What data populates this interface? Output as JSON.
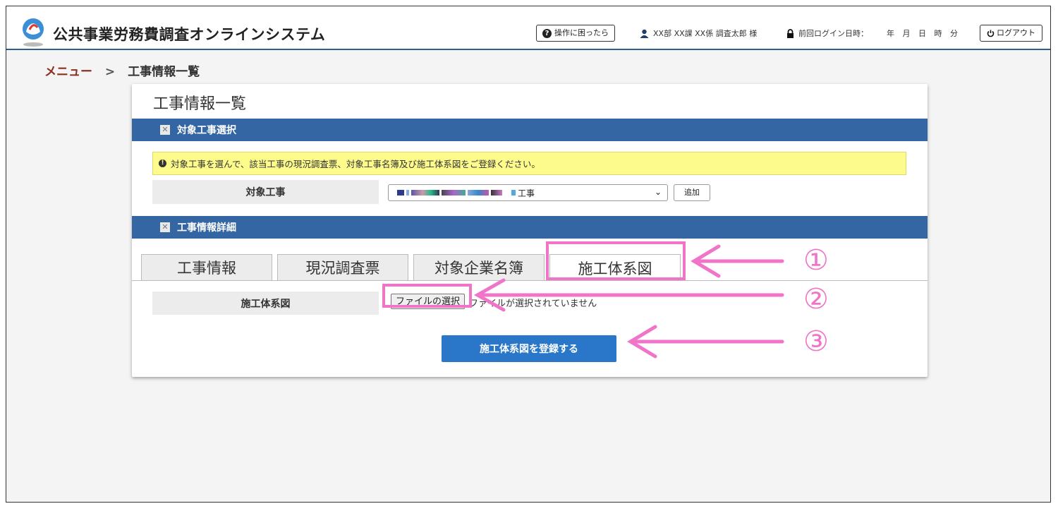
{
  "header": {
    "app_title": "公共事業労務費調査オンラインシステム",
    "help_label": "操作に困ったら",
    "user_label": "XX部 XX課 XX係 調査太郎 様",
    "last_login_label": "前回ログイン日時：",
    "last_login_value": "年 月 日 時 分",
    "logout_label": "ログアウト",
    "icons": [
      "logo",
      "help-icon",
      "user-icon",
      "lock-icon",
      "power-icon"
    ]
  },
  "breadcrumb": {
    "menu": "メニュー",
    "separator": ">",
    "current": "工事情報一覧"
  },
  "panel": {
    "title": "工事情報一覧",
    "section1_title": "対象工事選択",
    "notice": "対象工事を選んで、該当工事の現況調査票、対象工事名簿及び施工体系図をご登録ください。",
    "target_label": "対象工事",
    "target_select_value": "工事",
    "add_button": "追加",
    "section2_title": "工事情報詳細",
    "tabs": [
      "工事情報",
      "現況調査票",
      "対象企業名簿",
      "施工体系図"
    ],
    "active_tab": "施工体系図",
    "file_label": "施工体系図",
    "file_button": "ファイルの選択",
    "file_status": "ファイルが選択されていません",
    "register_button": "施工体系図を登録する"
  },
  "annotations": {
    "numbers": [
      "①",
      "②",
      "③"
    ],
    "color": "#f074c8"
  },
  "colors": {
    "section_bar": "#3366a2",
    "register_button": "#2a77c9",
    "notice_bg": "#fdfb8c",
    "breadcrumb_link": "#8b2f1f"
  }
}
